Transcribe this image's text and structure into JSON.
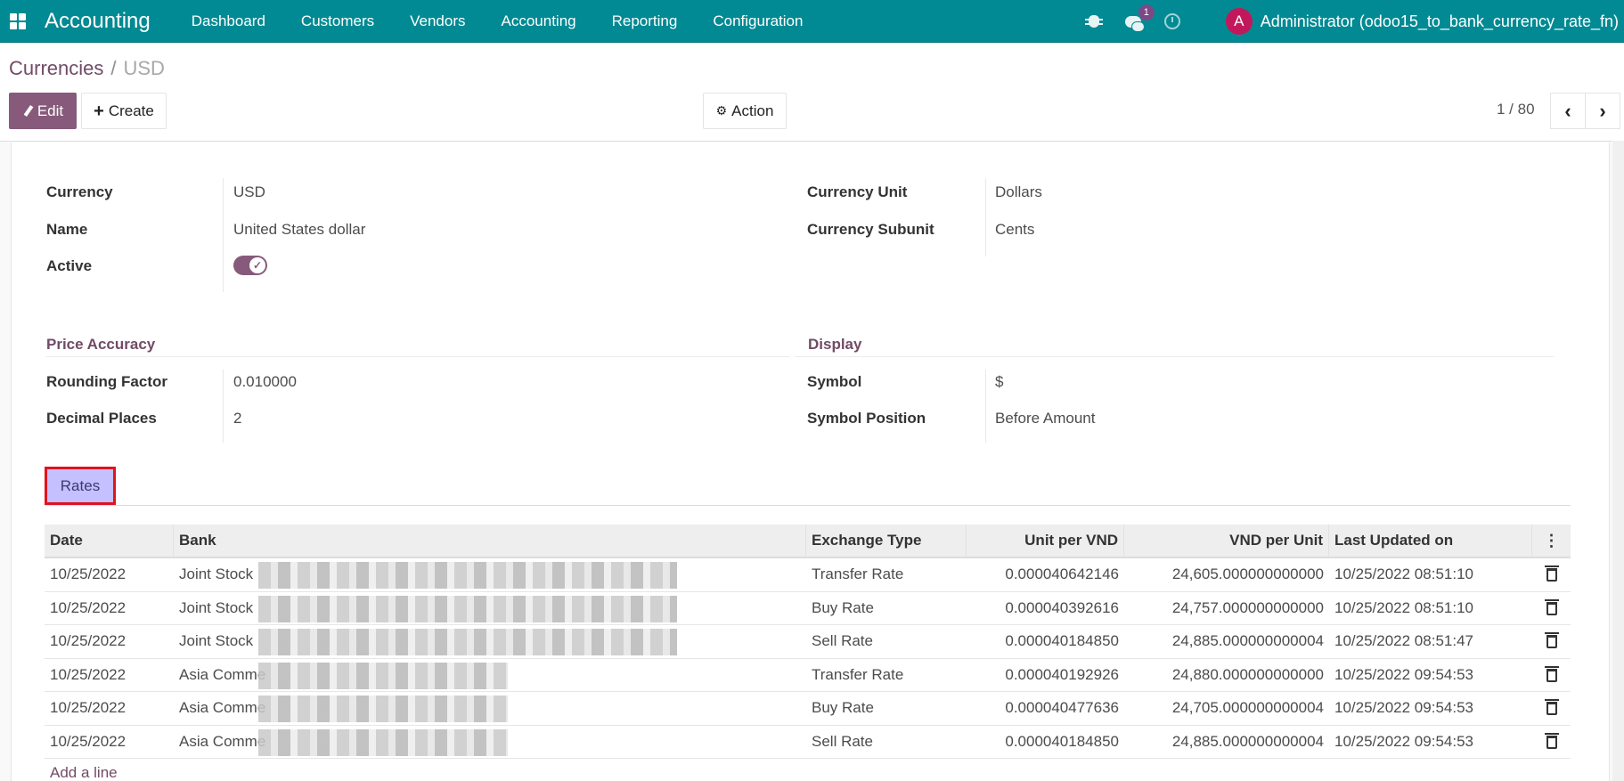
{
  "navbar": {
    "app_name": "Accounting",
    "menu": [
      "Dashboard",
      "Customers",
      "Vendors",
      "Accounting",
      "Reporting",
      "Configuration"
    ],
    "chat_badge": "1",
    "user_initial": "A",
    "user_name": "Administrator (odoo15_to_bank_currency_rate_fn)",
    "colors": {
      "bar": "#018a93",
      "avatar": "#c2185b",
      "badge": "#7b4a86"
    }
  },
  "breadcrumb": {
    "parent": "Currencies",
    "separator": "/",
    "current": "USD"
  },
  "toolbar": {
    "edit_label": "Edit",
    "create_label": "Create",
    "action_label": "Action",
    "pager_value": "1 / 80",
    "prev_glyph": "‹",
    "next_glyph": "›"
  },
  "form": {
    "left": [
      {
        "label": "Currency",
        "value": "USD"
      },
      {
        "label": "Name",
        "value": "United States dollar"
      },
      {
        "label": "Active",
        "value": true
      }
    ],
    "right": [
      {
        "label": "Currency Unit",
        "value": "Dollars"
      },
      {
        "label": "Currency Subunit",
        "value": "Cents"
      }
    ],
    "price_accuracy": {
      "title": "Price Accuracy",
      "fields": [
        {
          "label": "Rounding Factor",
          "value": "0.010000"
        },
        {
          "label": "Decimal Places",
          "value": "2"
        }
      ]
    },
    "display": {
      "title": "Display",
      "fields": [
        {
          "label": "Symbol",
          "value": "$"
        },
        {
          "label": "Symbol Position",
          "value": "Before Amount"
        }
      ]
    },
    "accent_color": "#875a7b"
  },
  "tabs": [
    {
      "label": "Rates",
      "active": true
    }
  ],
  "rates_table": {
    "columns": [
      "Date",
      "Bank",
      "Exchange Type",
      "Unit per VND",
      "VND per Unit",
      "Last Updated on"
    ],
    "rows": [
      {
        "date": "10/25/2022",
        "bank": "Joint Stock",
        "type": "Transfer Rate",
        "unit_per_vnd": "0.000040642146",
        "vnd_per_unit": "24,605.000000000000",
        "updated": "10/25/2022 08:51:10"
      },
      {
        "date": "10/25/2022",
        "bank": "Joint Stock",
        "type": "Buy Rate",
        "unit_per_vnd": "0.000040392616",
        "vnd_per_unit": "24,757.000000000000",
        "updated": "10/25/2022 08:51:10"
      },
      {
        "date": "10/25/2022",
        "bank": "Joint Stock",
        "type": "Sell Rate",
        "unit_per_vnd": "0.000040184850",
        "vnd_per_unit": "24,885.000000000004",
        "updated": "10/25/2022 08:51:47"
      },
      {
        "date": "10/25/2022",
        "bank": "Asia Comme",
        "type": "Transfer Rate",
        "unit_per_vnd": "0.000040192926",
        "vnd_per_unit": "24,880.000000000000",
        "updated": "10/25/2022 09:54:53"
      },
      {
        "date": "10/25/2022",
        "bank": "Asia Comme",
        "type": "Buy Rate",
        "unit_per_vnd": "0.000040477636",
        "vnd_per_unit": "24,705.000000000004",
        "updated": "10/25/2022 09:54:53"
      },
      {
        "date": "10/25/2022",
        "bank": "Asia Comme",
        "type": "Sell Rate",
        "unit_per_vnd": "0.000040184850",
        "vnd_per_unit": "24,885.000000000004",
        "updated": "10/25/2022 09:54:53"
      }
    ],
    "add_line_label": "Add a line"
  }
}
